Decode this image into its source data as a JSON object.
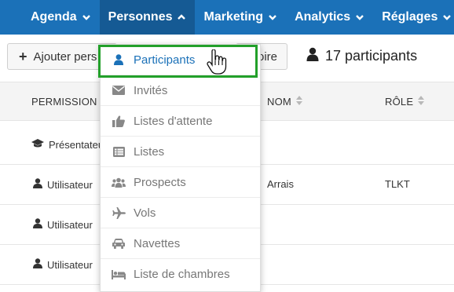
{
  "nav": {
    "items": [
      {
        "label": "Agenda"
      },
      {
        "label": "Personnes"
      },
      {
        "label": "Marketing"
      },
      {
        "label": "Analytics"
      },
      {
        "label": "Réglages"
      }
    ]
  },
  "toolbar": {
    "add_label": "Ajouter pers",
    "dir_label": "oire",
    "count_label": "17 participants"
  },
  "table": {
    "headers": {
      "permission": "PERMISSION",
      "nom": "NOM",
      "role": "RÔLE"
    },
    "rows": [
      {
        "permission": "Présentateur",
        "nom": "",
        "role": ""
      },
      {
        "permission": "Utilisateur",
        "nom": "Arrais",
        "role": "TLKT"
      },
      {
        "permission": "Utilisateur",
        "nom": "",
        "role": ""
      },
      {
        "permission": "Utilisateur",
        "nom": "",
        "role": ""
      }
    ]
  },
  "dropdown": {
    "items": [
      {
        "label": "Participants",
        "icon": "user-icon"
      },
      {
        "label": "Invités",
        "icon": "envelope-icon"
      },
      {
        "label": "Listes d'attente",
        "icon": "thumbs-up-icon"
      },
      {
        "label": "Listes",
        "icon": "list-icon"
      },
      {
        "label": "Prospects",
        "icon": "users-icon"
      },
      {
        "label": "Vols",
        "icon": "plane-icon"
      },
      {
        "label": "Navettes",
        "icon": "car-icon"
      },
      {
        "label": "Liste de chambres",
        "icon": "bed-icon"
      }
    ]
  },
  "colors": {
    "nav_bg": "#1b71b8",
    "nav_active": "#155a94",
    "highlight": "#22a02a",
    "selected_text": "#1b71b8"
  }
}
